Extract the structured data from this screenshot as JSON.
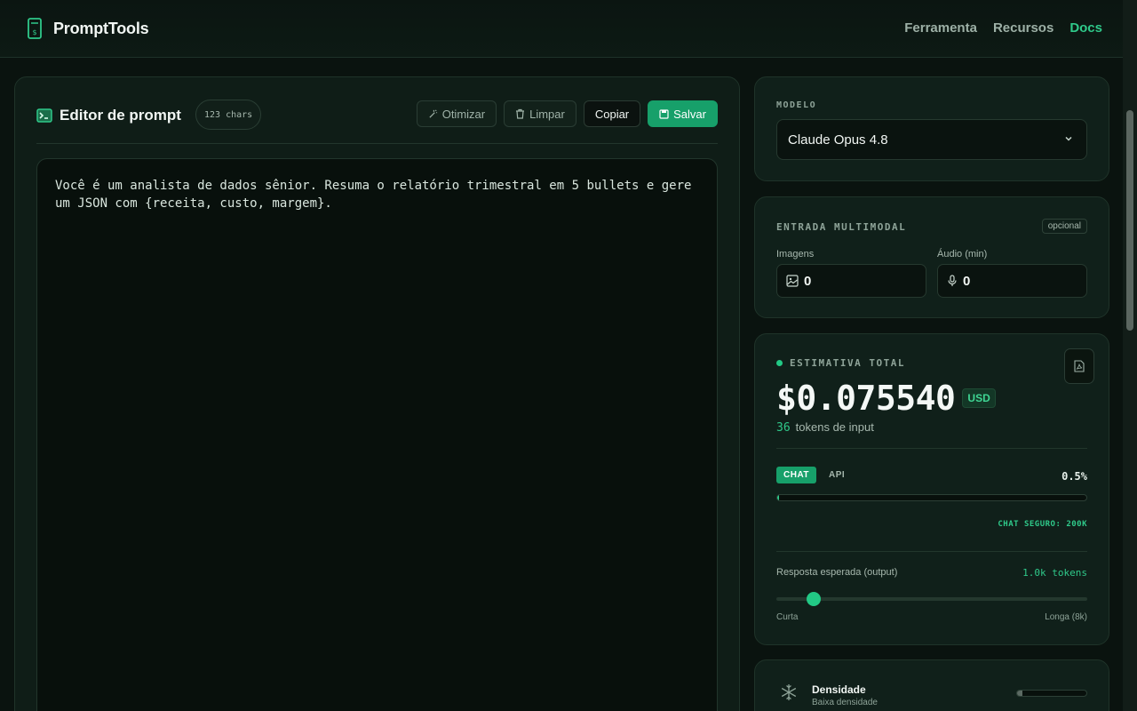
{
  "header": {
    "brand": "PromptTools",
    "nav": [
      "Ferramenta",
      "Recursos",
      "Docs"
    ]
  },
  "editor": {
    "title": "Editor de prompt",
    "char_count": "123 chars",
    "buttons": {
      "optimize": "Otimizar",
      "clear": "Limpar",
      "copy": "Copiar",
      "save": "Salvar"
    },
    "text": "Você é um analista de dados sênior. Resuma o relatório trimestral em 5 bullets e gere um JSON com {receita, custo, margem}."
  },
  "model": {
    "label": "MODELO",
    "selected": "Claude Opus 4.8"
  },
  "multimodal": {
    "label": "ENTRADA MULTIMODAL",
    "optional": "opcional",
    "images_label": "Imagens",
    "images_value": "0",
    "audio_label": "Áudio (min)",
    "audio_value": "0"
  },
  "estimate": {
    "label": "ESTIMATIVA TOTAL",
    "price": "$0.075540",
    "currency": "USD",
    "tokens": "36",
    "tokens_label": "tokens de input",
    "tabs": [
      "CHAT",
      "API"
    ],
    "percent_label": "0.5%",
    "context_fill": 0.005,
    "safe_label": "CHAT SEGURO: 200K",
    "response_label": "Resposta esperada (output)",
    "response_value": "1.0k tokens",
    "slider_fraction": 0.12,
    "slider_min": "Curta",
    "slider_max": "Longa (8k)"
  },
  "density": {
    "title": "Densidade",
    "subtitle": "Baixa densidade",
    "fill": 0.08
  },
  "colors": {
    "accent": "#2fc98a",
    "button": "#17a06a",
    "background": "#0a130f"
  }
}
